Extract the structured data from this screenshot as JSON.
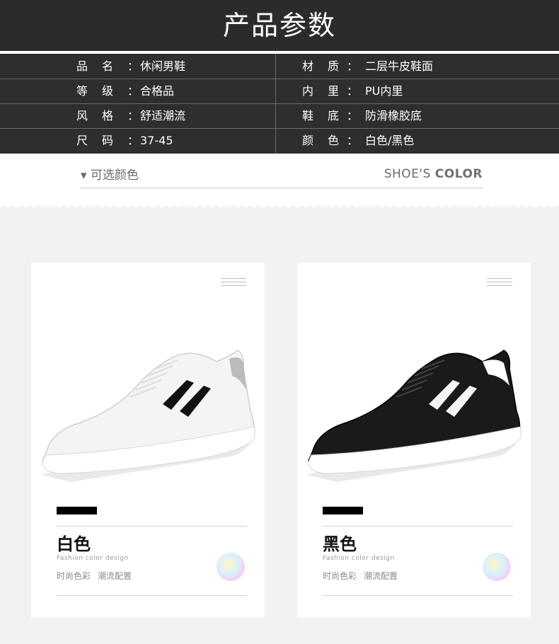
{
  "header": {
    "title": "产品参数"
  },
  "params": [
    {
      "left_label": "品名",
      "left_value": "休闲男鞋",
      "right_label": "材质",
      "right_value": "二层牛皮鞋面"
    },
    {
      "left_label": "等级",
      "left_value": "合格品",
      "right_label": "内里",
      "right_value": "PU内里"
    },
    {
      "left_label": "风格",
      "left_value": "舒适潮流",
      "right_label": "鞋底",
      "right_value": "防滑橡胶底"
    },
    {
      "left_label": "尺码",
      "left_value": "37-45",
      "right_label": "颜色",
      "right_value": "白色/黑色"
    }
  ],
  "colon": "：",
  "selector": {
    "left": "▾ 可选颜色",
    "right_prefix": "SHOE'S ",
    "right_bold": "COLOR"
  },
  "cards": [
    {
      "name": "白色",
      "fashion": "Fashion color design",
      "tag1": "时尚色彩",
      "tag2": "潮流配置",
      "shoe_color": "#f4f4f4",
      "stripe_color": "#111111"
    },
    {
      "name": "黑色",
      "fashion": "Fashion color design",
      "tag1": "时尚色彩",
      "tag2": "潮流配置",
      "shoe_color": "#1a1a1a",
      "stripe_color": "#f5f5f5"
    }
  ],
  "colors": {
    "header_bg": "#2b2b2b",
    "table_bg": "#2e2e2e",
    "section_bg": "#f2f2f2"
  }
}
